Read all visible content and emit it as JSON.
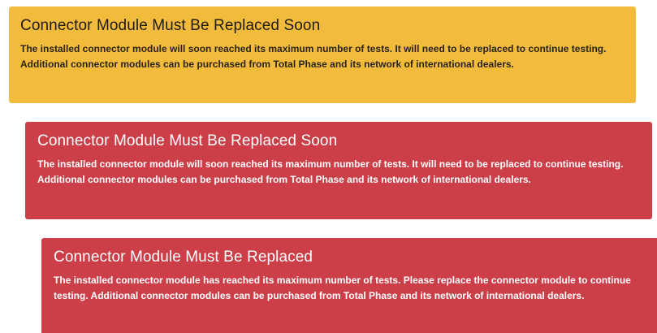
{
  "alerts": [
    {
      "variant": "warning",
      "color": "#f3bb3c",
      "title": "Connector Module Must Be Replaced Soon",
      "message": "The installed connector module will soon reached its maximum number of tests. It will need to be replaced to continue testing. Additional connector modules can be purchased from Total Phase and its network of international dealers."
    },
    {
      "variant": "danger",
      "color": "#cc3e48",
      "title": "Connector Module Must Be Replaced Soon",
      "message": "The installed connector module will soon reached its maximum number of tests. It will need to be replaced to continue testing. Additional connector modules can be purchased from Total Phase and its network of international dealers."
    },
    {
      "variant": "danger",
      "color": "#cc3e48",
      "title": "Connector Module Must Be Replaced",
      "message": "The installed connector module has reached its maximum number of tests. Please replace the connector module to continue testing. Additional connector modules can be purchased from Total Phase and its network of international dealers."
    }
  ]
}
